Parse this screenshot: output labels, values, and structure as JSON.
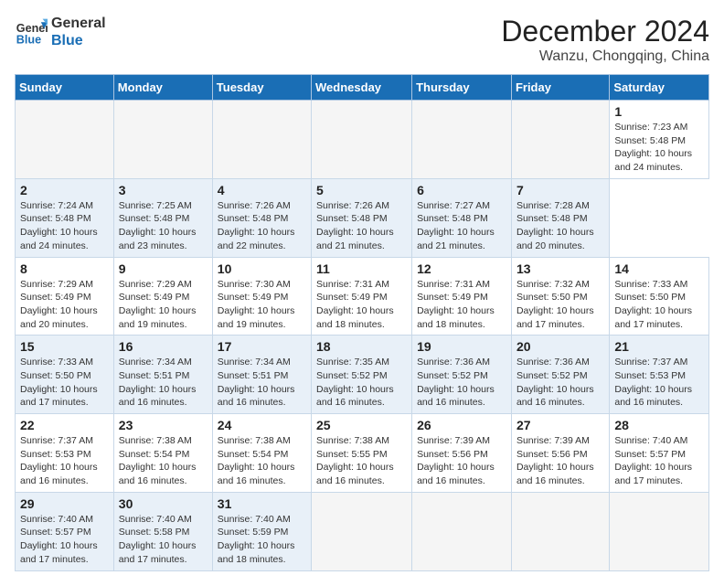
{
  "header": {
    "logo_general": "General",
    "logo_blue": "Blue",
    "month_title": "December 2024",
    "location": "Wanzu, Chongqing, China"
  },
  "calendar": {
    "days_of_week": [
      "Sunday",
      "Monday",
      "Tuesday",
      "Wednesday",
      "Thursday",
      "Friday",
      "Saturday"
    ],
    "weeks": [
      [
        null,
        null,
        null,
        null,
        null,
        null,
        null
      ]
    ]
  },
  "cells": {
    "week1": [
      {
        "day": null
      },
      {
        "day": null
      },
      {
        "day": null
      },
      {
        "day": null
      },
      {
        "day": null
      },
      {
        "day": null
      },
      {
        "day": null
      }
    ]
  }
}
